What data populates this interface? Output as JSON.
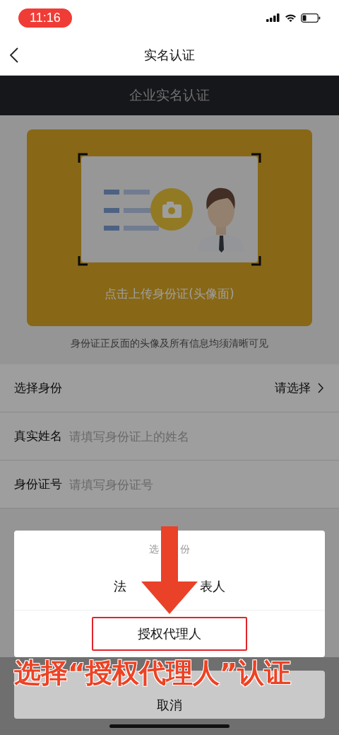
{
  "status_bar": {
    "time": "11:16"
  },
  "nav": {
    "title": "实名认证"
  },
  "banner": {
    "title": "企业实名认证"
  },
  "upload": {
    "label": "点击上传身份证(头像面)",
    "hint": "身份证正反面的头像及所有信息均须清晰可见"
  },
  "form": [
    {
      "kind": "select",
      "label": "选择身份",
      "value": "请选择"
    },
    {
      "kind": "input",
      "label": "真实姓名",
      "placeholder": "请填写身份证上的姓名"
    },
    {
      "kind": "input",
      "label": "身份证号",
      "placeholder": "请填写身份证号"
    }
  ],
  "sheet": {
    "title_fragments": [
      "选",
      "份"
    ],
    "options": [
      {
        "label_fragments": [
          "法",
          "表人"
        ],
        "highlighted": false
      },
      {
        "label_fragments": [
          "授权代理人"
        ],
        "highlighted": true
      }
    ],
    "cancel": "取消"
  },
  "annotation": {
    "caption": "选择“授权代理人”认证"
  }
}
